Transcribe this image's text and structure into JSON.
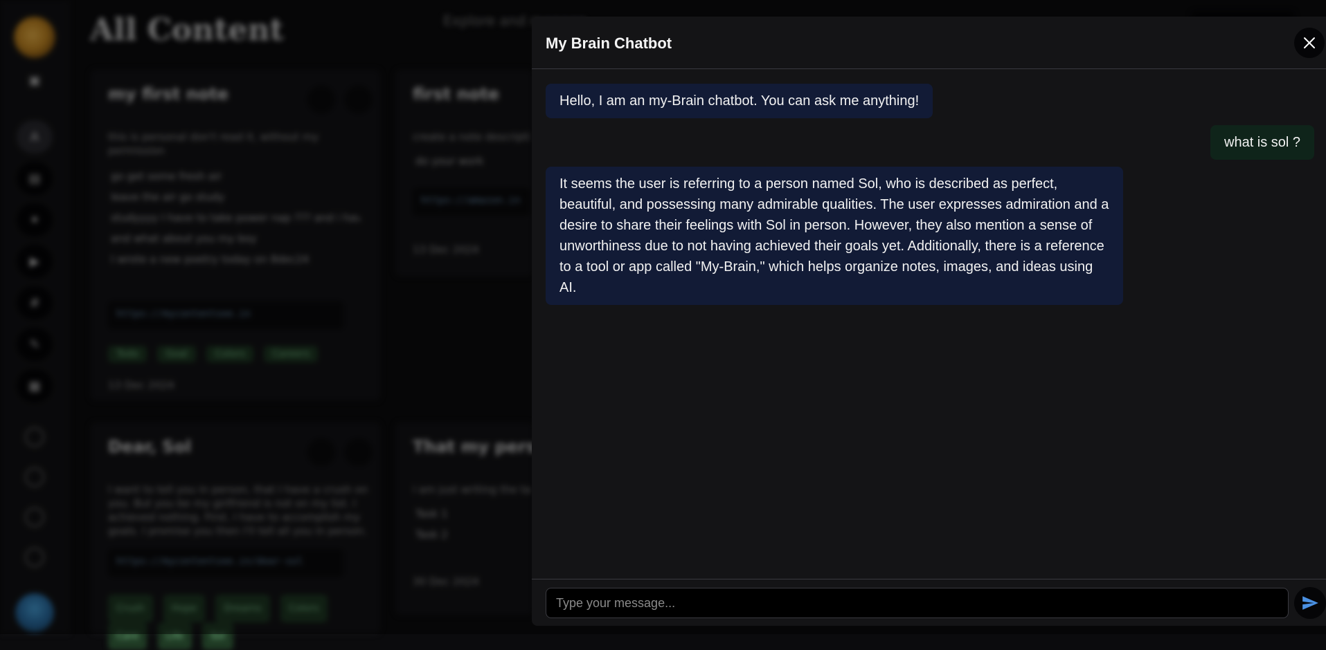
{
  "background": {
    "page_title": "All Content",
    "subtitle": "Explore and manage",
    "cards": [
      {
        "title": "my first note",
        "description": "this is personal don't read it, without my permission",
        "list": [
          "go get some fresh air",
          "leave the air go study",
          "studyyyy I have to take power nap ??? and i have many plans",
          "and what about you my boy",
          "I wrote a new poetry today on 8dec24"
        ],
        "link": "https://mycontentsee.in",
        "tags": [
          "Todo",
          "Goal",
          "Colors",
          "Careers"
        ],
        "date": "13 Dec 2024"
      },
      {
        "title": "first note",
        "description": "create a note description",
        "list": [
          "do your work"
        ],
        "link": "https://amazon.in",
        "tags": [],
        "date": "13 Dec 2024"
      },
      {
        "title": "Dear, Sol",
        "description": "I want to tell you in person, that I have a crush on you. But you be my girlfriend is not on my list. I achieved nothing. First, I have to accomplish my goals. I promise you then I'll tell all you in person.",
        "list": [],
        "link": "https://mycontentsee.in/dear-sol",
        "tags": [
          "Crush",
          "Hope",
          "Dreams",
          "Colors",
          "Care",
          "Life",
          "Sol"
        ],
        "date": ""
      },
      {
        "title": "That my personal",
        "description": "i am just writing the task",
        "list": [
          "Task 1",
          "Task 2"
        ],
        "link": "",
        "tags": [],
        "date": "30 Dec 2024"
      }
    ]
  },
  "chat": {
    "title": "My Brain Chatbot",
    "messages": [
      {
        "role": "bot",
        "text": "Hello, I am an my-Brain chatbot. You can ask me anything!"
      },
      {
        "role": "user",
        "text": "what is sol ?"
      },
      {
        "role": "bot",
        "text": "It seems the user is referring to a person named Sol, who is described as perfect, beautiful, and possessing many admirable qualities. The user expresses admiration and a desire to share their feelings with Sol in person. However, they also mention a sense of unworthiness due to not having achieved their goals yet. Additionally, there is a reference to a tool or app called \"My-Brain,\" which helps organize notes, images, and ideas using AI."
      }
    ],
    "input_placeholder": "Type your message...",
    "input_value": "",
    "close_icon": "close-icon",
    "send_icon": "send-icon"
  },
  "colors": {
    "panel_bg": "#141416",
    "bot_bubble": "#121b36",
    "user_bubble": "#0f241a",
    "send_icon": "#4a90e2"
  }
}
